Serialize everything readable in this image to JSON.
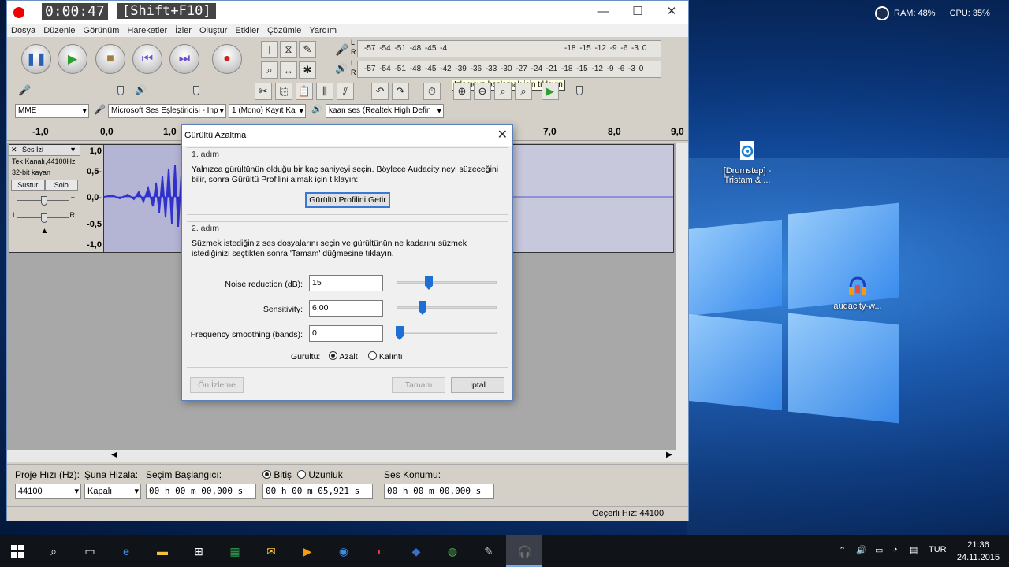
{
  "desktop": {
    "sysmon": {
      "ram": "RAM: 48%",
      "cpu": "CPU: 35%"
    },
    "icons": [
      {
        "label": "[Drumstep] - Tristam & ...",
        "icon": "audio-file-icon"
      },
      {
        "label": "audacity-w...",
        "icon": "audacity-icon"
      }
    ]
  },
  "recorder": {
    "time": "0:00:47",
    "hotkey": "[Shift+F10]"
  },
  "app": {
    "menu": [
      "Dosya",
      "Düzenle",
      "Görünüm",
      "Hareketler",
      "İzler",
      "Oluştur",
      "Etkiler",
      "Çözümle",
      "Yardım"
    ],
    "meter_tooltip": "İzlemeye başlamak için tıklayın",
    "meter_scale": "-57 -54 -51 -48 -45 -42 -39 -36 -33 -30 -27 -24 -21 -18 -15 -12 -9 -6 -3 0",
    "meter_scale_top": "-57 -54 -51 -48 -45 -4",
    "meter_scale_top_right": "-18 -15 -12 -9 -6 -3 0",
    "meter_lr": {
      "l": "L",
      "r": "R"
    },
    "devices": {
      "host": "MME",
      "input": "Microsoft Ses Eşleştiricisi - Inp",
      "channels": "1 (Mono) Kayıt Ka",
      "output": "kaan ses (Realtek High Defin"
    },
    "ruler": [
      "-1,0",
      "0,0",
      "1,0",
      "7,0",
      "8,0",
      "9,0"
    ],
    "track": {
      "name": "Ses İzi",
      "rate": "Tek Kanalı,44100Hz",
      "format": "32-bit kayan",
      "mute": "Sustur",
      "solo": "Solo",
      "gain_minus": "-",
      "gain_plus": "+",
      "pan_l": "L",
      "pan_r": "R",
      "scale": [
        "1,0",
        "0,5-",
        "0,0-",
        "-0,5",
        "-1,0"
      ]
    },
    "selection": {
      "rate_label": "Proje Hızı (Hz):",
      "rate_value": "44100",
      "snap_label": "Şuna Hizala:",
      "snap_value": "Kapalı",
      "start_label": "Seçim Başlangıcı:",
      "start_value": "00 h 00 m 00,000 s",
      "end_label": "Bitiş",
      "length_label": "Uzunluk",
      "end_value": "00 h 00 m 05,921 s",
      "pos_label": "Ses Konumu:",
      "pos_value": "00 h 00 m 00,000 s"
    },
    "status": "Geçerli Hız: 44100"
  },
  "dialog": {
    "title": "Gürültü Azaltma",
    "step1_head": "1. adım",
    "step1_text": "Yalnızca gürültünün olduğu bir kaç saniyeyi seçin. Böylece Audacity neyi süzeceğini bilir, sonra Gürültü Profilini almak için tıklayın:",
    "get_profile": "Gürültü Profilini Getir",
    "step2_head": "2. adım",
    "step2_text": "Süzmek istediğiniz ses dosyalarını seçin ve gürültünün ne kadarını süzmek istediğinizi seçtikten sonra 'Tamam' düğmesine tıklayın.",
    "fields": [
      {
        "label": "Noise reduction (dB):",
        "value": "15"
      },
      {
        "label": "Sensitivity:",
        "value": "6,00"
      },
      {
        "label": "Frequency smoothing (bands):",
        "value": "0"
      }
    ],
    "noise_label": "Gürültü:",
    "opt_reduce": "Azalt",
    "opt_residue": "Kalıntı",
    "preview": "Ön İzleme",
    "ok": "Tamam",
    "cancel": "İptal"
  },
  "taskbar": {
    "lang": "TUR",
    "time": "21:36",
    "date": "24.11.2015"
  }
}
